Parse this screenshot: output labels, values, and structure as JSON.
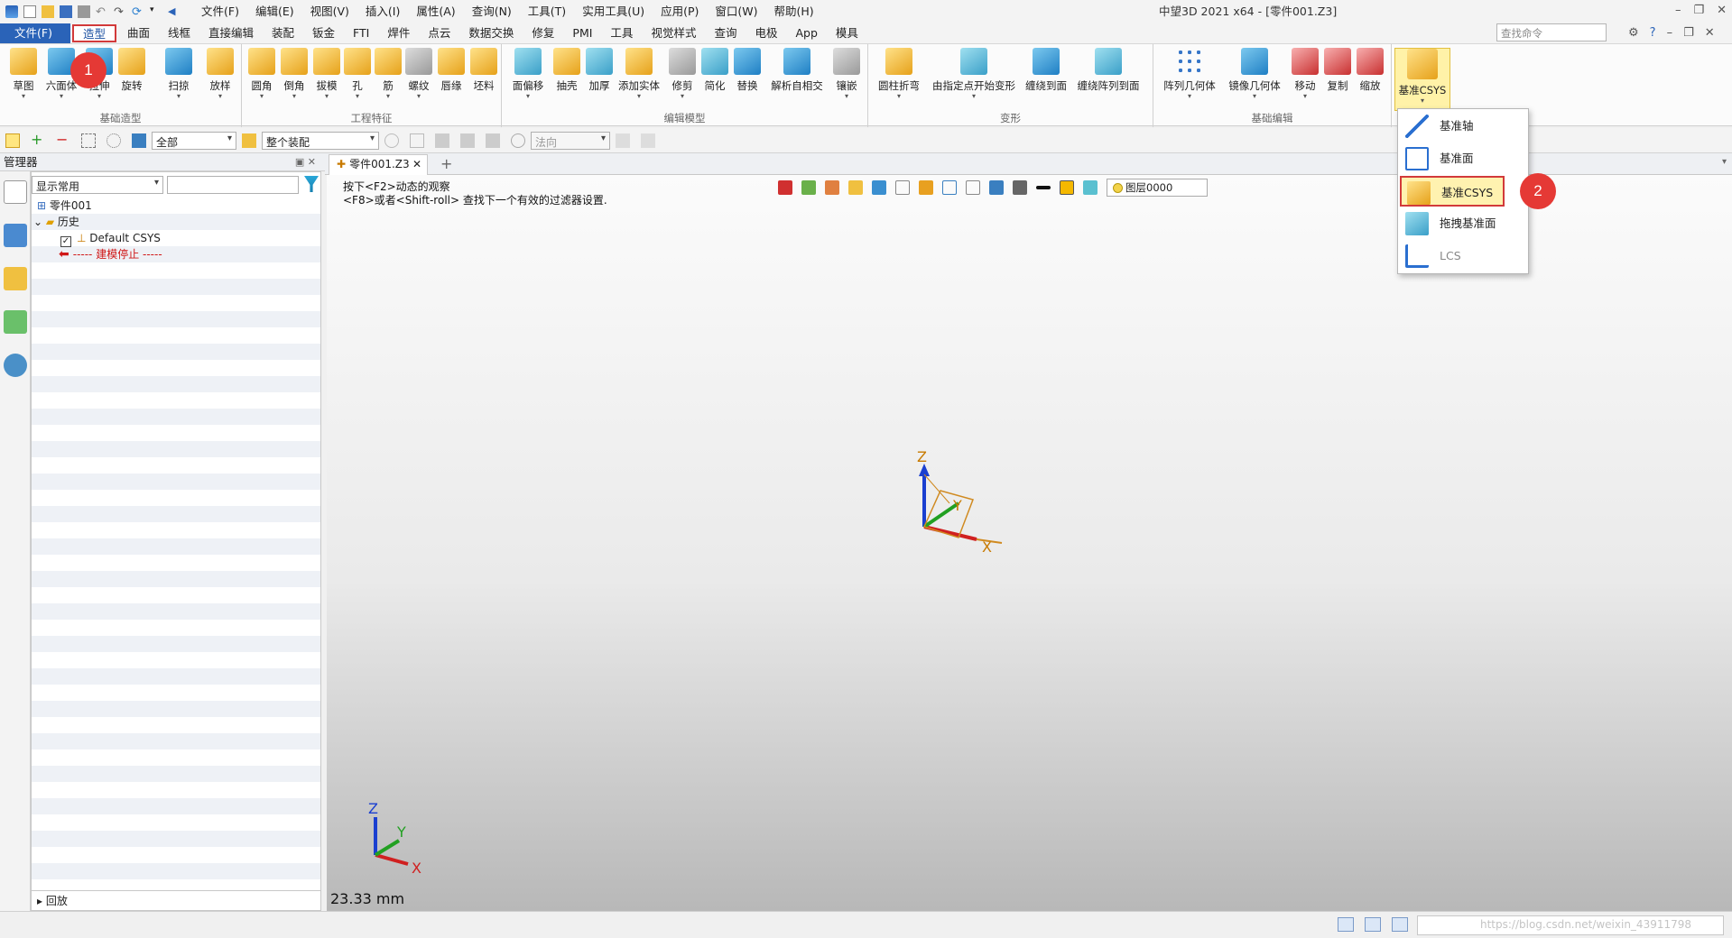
{
  "window": {
    "title": "中望3D 2021 x64 - [零件001.Z3]"
  },
  "menus": [
    "文件(F)",
    "编辑(E)",
    "视图(V)",
    "插入(I)",
    "属性(A)",
    "查询(N)",
    "工具(T)",
    "实用工具(U)",
    "应用(P)",
    "窗口(W)",
    "帮助(H)"
  ],
  "tabs": [
    "文件(F)",
    "造型",
    "曲面",
    "线框",
    "直接编辑",
    "装配",
    "钣金",
    "FTI",
    "焊件",
    "点云",
    "数据交换",
    "修复",
    "PMI",
    "工具",
    "视觉样式",
    "查询",
    "电极",
    "App",
    "模具"
  ],
  "search": {
    "placeholder": "查找命令"
  },
  "ribbon": {
    "groups": [
      "基础造型",
      "工程特征",
      "编辑模型",
      "变形",
      "基础编辑"
    ],
    "buttons": [
      "草图",
      "六面体",
      "拉伸",
      "旋转",
      "扫掠",
      "放样",
      "圆角",
      "倒角",
      "拔模",
      "孔",
      "筋",
      "螺纹",
      "唇缘",
      "坯料",
      "面偏移",
      "抽壳",
      "加厚",
      "添加实体",
      "修剪",
      "简化",
      "替换",
      "解析自相交",
      "镶嵌",
      "圆柱折弯",
      "由指定点开始变形",
      "缠绕到面",
      "缠绕阵列到面",
      "阵列几何体",
      "镜像几何体",
      "移动",
      "复制",
      "缩放",
      "基准CSYS"
    ]
  },
  "badges": [
    "1",
    "2"
  ],
  "filters": {
    "scope": "全部",
    "assembly": "整个装配",
    "direction": "法向"
  },
  "manager": {
    "title": "管理器",
    "filter": "显示常用"
  },
  "tree": {
    "part": "零件001",
    "history": "历史",
    "csys": "Default CSYS",
    "stop": "----- 建模停止 -----",
    "playback": "回放"
  },
  "doc": {
    "tab": "零件001.Z3"
  },
  "hint": {
    "line1": "按下<F2>动态的观察",
    "line2": "<F8>或者<Shift-roll> 查找下一个有效的过滤器设置."
  },
  "layer": "图层0000",
  "scale": "23.33 mm",
  "axes": {
    "x": "X",
    "y": "Y",
    "z": "Z"
  },
  "dropdown": [
    "基准轴",
    "基准面",
    "基准CSYS",
    "拖拽基准面",
    "LCS"
  ],
  "watermark": "https://blog.csdn.net/weixin_43911798",
  "colors": {
    "file_tab": "#2a63b8",
    "highlight": "#d23a3a",
    "badge": "#e53935"
  }
}
